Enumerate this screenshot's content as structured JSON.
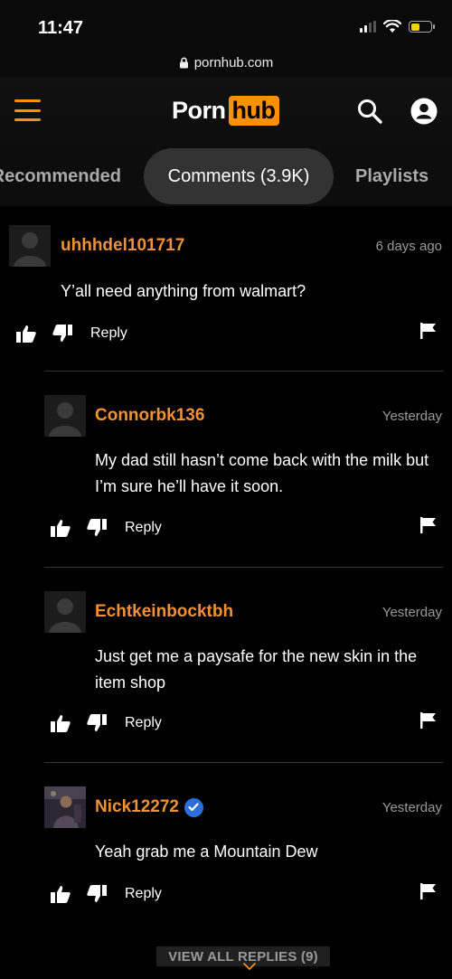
{
  "status": {
    "time": "11:47"
  },
  "browser": {
    "url": "pornhub.com"
  },
  "header": {
    "logo_left": "Porn",
    "logo_right": "hub",
    "accent": "#ff9000"
  },
  "tabs": [
    {
      "label": "Recommended"
    },
    {
      "label": "Comments (3.9K)"
    },
    {
      "label": "Playlists"
    }
  ],
  "actions": {
    "reply_label": "Reply"
  },
  "comments": [
    {
      "user": "uhhhdel101717",
      "time": "6 days ago",
      "text": "Y’all need anything from walmart?"
    },
    {
      "user": "Connorbk136",
      "time": "Yesterday",
      "text": "My dad still hasn’t come back with the milk but I’m sure he’ll have it soon."
    },
    {
      "user": "Echtkeinbocktbh",
      "time": "Yesterday",
      "text": "Just get me a paysafe for the new skin in the item shop"
    },
    {
      "user": "Nick12272",
      "time": "Yesterday",
      "text": "Yeah grab me a Mountain Dew",
      "verified": true
    }
  ],
  "view_all": "VIEW ALL REPLIES (9)",
  "colors": {
    "username": "#ef9236",
    "background": "#000000",
    "verified": "#2c6fd8"
  }
}
